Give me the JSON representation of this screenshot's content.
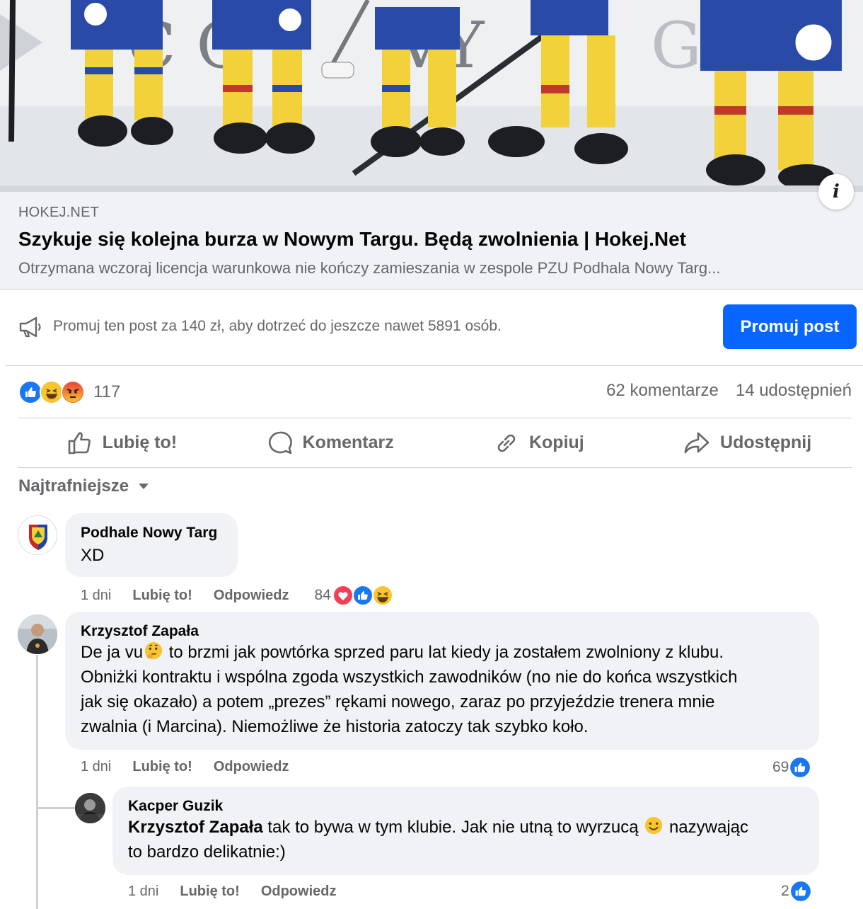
{
  "link": {
    "domain": "HOKEJ.NET",
    "title": "Szykuje się kolejna burza w Nowym Targu. Będą zwolnienia | Hokej.Net",
    "description": "Otrzymana wczoraj licencja warunkowa nie kończy zamieszania w zespole PZU Podhala Nowy Targ..."
  },
  "promote": {
    "text": "Promuj ten post za 140 zł, aby dotrzeć do jeszcze nawet 5891 osób.",
    "button": "Promuj post"
  },
  "reactions": {
    "count": "117",
    "comments": "62 komentarze",
    "shares": "14 udostępnień"
  },
  "actions": {
    "like": "Lubię to!",
    "comment": "Komentarz",
    "copy": "Kopiuj",
    "share": "Udostępnij"
  },
  "sort": "Najtrafniejsze",
  "comments": [
    {
      "author": "Podhale Nowy Targ",
      "text": "XD",
      "time": "1 dni",
      "like": "Lubię to!",
      "reply": "Odpowiedz",
      "reactions": "84"
    },
    {
      "author": "Krzysztof Zapała",
      "text_lines": [
        "De ja vu",
        " to brzmi jak powtórka sprzed paru lat kiedy ja zostałem zwolniony z klubu.",
        "Obniżki kontraktu i wspólna zgoda wszystkich zawodników (no nie do końca wszystkich",
        "jak się okazało) a potem „prezes” rękami nowego, zaraz po przyjeździe trenera mnie",
        "zwalnia (i Marcina). Niemożliwe że historia zatoczy tak szybko koło."
      ],
      "time": "1 dni",
      "like": "Lubię to!",
      "reply": "Odpowiedz",
      "reactions": "69"
    },
    {
      "author": "Kacper Guzik",
      "mention": "Krzysztof Zapała",
      "text_a": " tak to bywa w tym klubie. Jak nie utną to wyrzucą ",
      "text_b": " nazywając",
      "text_c": "to bardzo delikatnie:)",
      "time": "1 dni",
      "like": "Lubię to!",
      "reply": "Odpowiedz",
      "reactions": "2"
    }
  ],
  "colors": {
    "accent": "#0866ff",
    "secondary_text": "#65676b",
    "bubble": "#f0f2f5"
  }
}
